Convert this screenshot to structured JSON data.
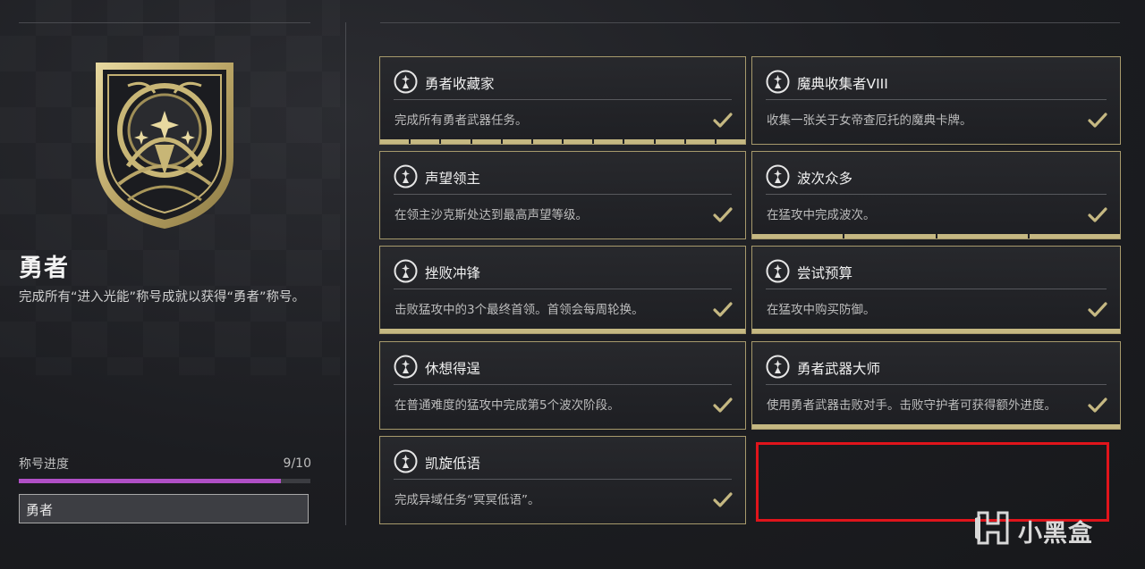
{
  "title": {
    "name": "勇者",
    "description": "完成所有“进入光能”称号成就以获得“勇者”称号。"
  },
  "progress": {
    "label": "称号进度",
    "count_text": "9/10",
    "completed": 9,
    "total": 10,
    "color": "#b04fc6"
  },
  "equipped_title": "勇者",
  "accent_color": "#c5b882",
  "highlight_color": "#e0141b",
  "triumphs": [
    {
      "title": "勇者收藏家",
      "description": "完成所有勇者武器任务。",
      "icon": "triumph-seal-icon",
      "completed": true,
      "bar_segments": 12
    },
    {
      "title": "魔典收集者VIII",
      "description": "收集一张关于女帝查厄托的魔典卡牌。",
      "icon": "triumph-seal-icon",
      "completed": true,
      "bar_segments": 0
    },
    {
      "title": "声望领主",
      "description": "在领主沙克斯处达到最高声望等级。",
      "icon": "triumph-seal-icon",
      "completed": true,
      "bar_segments": 0
    },
    {
      "title": "波次众多",
      "description": "在猛攻中完成波次。",
      "icon": "triumph-seal-icon",
      "completed": true,
      "bar_segments": 4
    },
    {
      "title": "挫败冲锋",
      "description": "击败猛攻中的3个最终首领。首领会每周轮换。",
      "icon": "triumph-seal-icon",
      "completed": true,
      "bar_segments": 1
    },
    {
      "title": "尝试预算",
      "description": "在猛攻中购买防御。",
      "icon": "triumph-seal-icon",
      "completed": true,
      "bar_segments": 1
    },
    {
      "title": "休想得逞",
      "description": "在普通难度的猛攻中完成第5个波次阶段。",
      "icon": "triumph-seal-icon",
      "completed": true,
      "bar_segments": 0
    },
    {
      "title": "勇者武器大师",
      "description": "使用勇者武器击败对手。击败守护者可获得额外进度。",
      "icon": "triumph-seal-icon",
      "completed": true,
      "bar_segments": 1
    },
    {
      "title": "凯旋低语",
      "description": "完成异域任务“冥冥低语”。",
      "icon": "triumph-seal-icon",
      "completed": true,
      "bar_segments": 0
    }
  ],
  "watermark": {
    "text": "小黑盒",
    "icon": "heybox-logo-icon"
  }
}
